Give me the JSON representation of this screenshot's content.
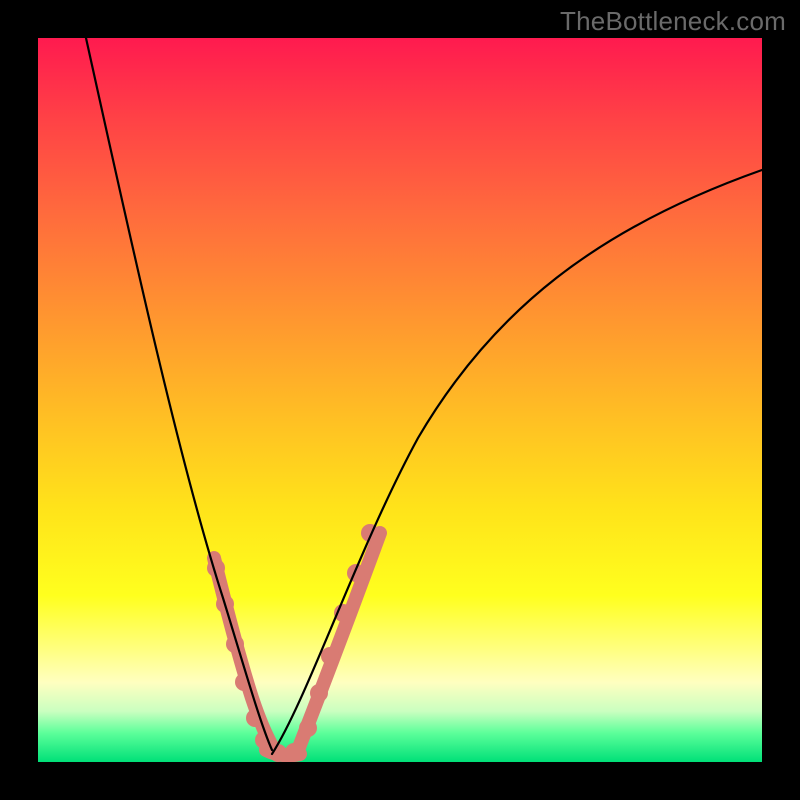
{
  "watermark": "TheBottleneck.com",
  "colors": {
    "background_black": "#000000",
    "segment": "#d97b73",
    "curve": "#000000",
    "gradient_top": "#ff1a4f",
    "gradient_bottom": "#00e078"
  },
  "chart_data": {
    "type": "line",
    "title": "",
    "xlabel": "",
    "ylabel": "",
    "xlim": [
      0,
      100
    ],
    "ylim": [
      0,
      100
    ],
    "grid": false,
    "legend": false,
    "series": [
      {
        "name": "left-curve",
        "x": [
          7,
          10,
          13,
          16,
          19,
          21,
          23,
          25,
          26.5,
          28,
          29.5,
          31,
          32.2
        ],
        "y": [
          100,
          87,
          74,
          61,
          48,
          39,
          31,
          23,
          17,
          11,
          6.5,
          3,
          1
        ]
      },
      {
        "name": "right-curve",
        "x": [
          32.2,
          35,
          38,
          42,
          47,
          53,
          60,
          68,
          77,
          87,
          100
        ],
        "y": [
          1,
          7,
          15,
          26,
          38,
          49,
          58,
          66,
          72,
          77,
          82
        ]
      }
    ],
    "highlighted_segments": [
      {
        "side": "left",
        "x_range": [
          24.0,
          31.5
        ],
        "y_range": [
          28,
          3
        ]
      },
      {
        "side": "floor",
        "x_range": [
          31.5,
          36.0
        ],
        "y_range": [
          1,
          1
        ]
      },
      {
        "side": "right",
        "x_range": [
          36.0,
          46.5
        ],
        "y_range": [
          9,
          37
        ]
      }
    ],
    "highlighted_points": [
      {
        "side": "left",
        "x": 24.5,
        "y": 26
      },
      {
        "side": "left",
        "x": 25.8,
        "y": 21
      },
      {
        "side": "left",
        "x": 27.2,
        "y": 15
      },
      {
        "side": "left",
        "x": 28.5,
        "y": 10
      },
      {
        "side": "left",
        "x": 30.0,
        "y": 5.5
      },
      {
        "side": "left",
        "x": 31.2,
        "y": 3
      },
      {
        "side": "floor",
        "x": 33.0,
        "y": 1.2
      },
      {
        "side": "floor",
        "x": 35.0,
        "y": 1.5
      },
      {
        "side": "right",
        "x": 37.0,
        "y": 6
      },
      {
        "side": "right",
        "x": 38.5,
        "y": 11
      },
      {
        "side": "right",
        "x": 40.0,
        "y": 16
      },
      {
        "side": "right",
        "x": 41.8,
        "y": 22
      },
      {
        "side": "right",
        "x": 43.5,
        "y": 28
      },
      {
        "side": "right",
        "x": 45.5,
        "y": 34
      }
    ],
    "notes": "Values are estimated from pixels; axes have no labels or ticks. y expressed as percent of plot height from bottom, x as percent from left."
  }
}
